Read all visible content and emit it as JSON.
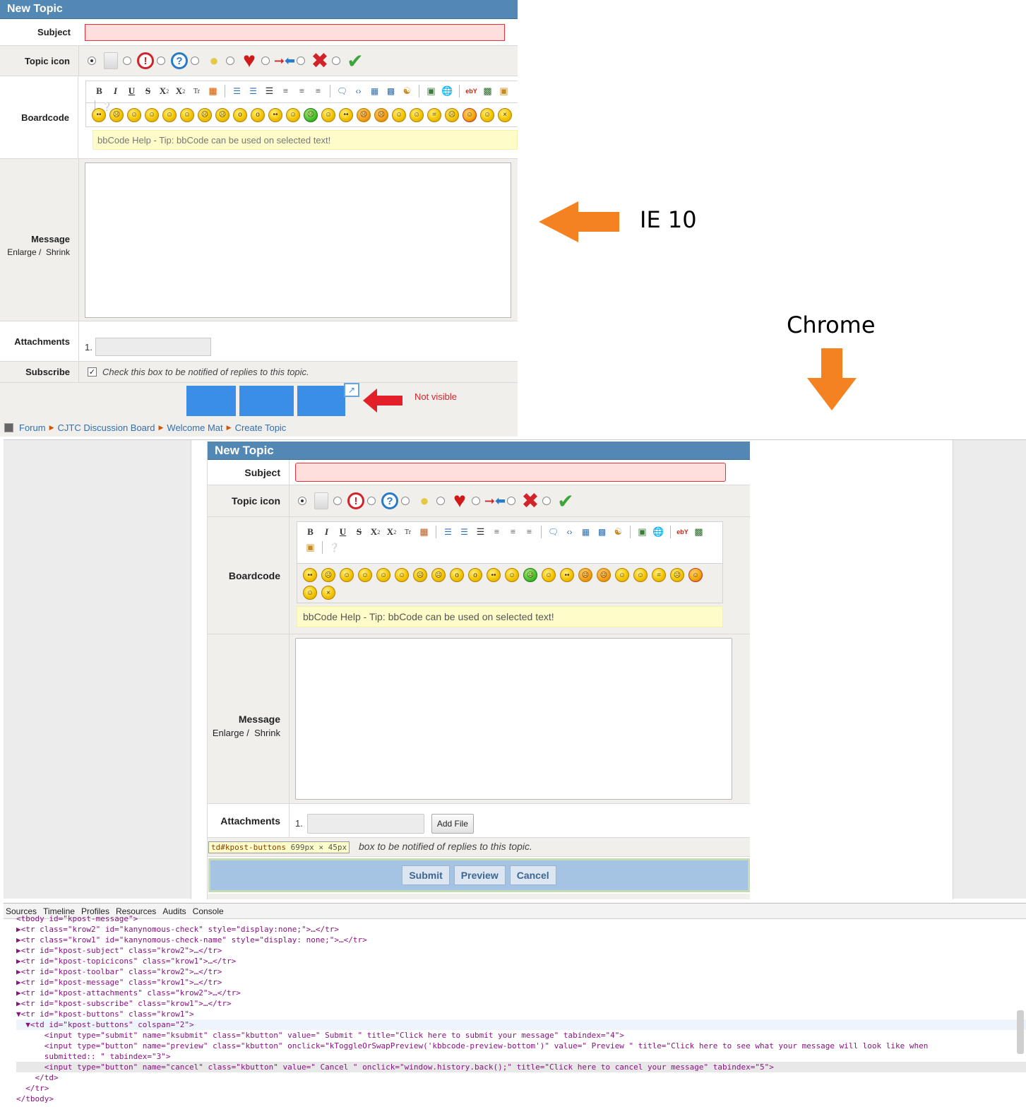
{
  "ie": {
    "title": "New Topic",
    "subject_label": "Subject",
    "topic_icon_label": "Topic icon",
    "boardcode_label": "Boardcode",
    "message_label": "Message",
    "enlarge": "Enlarge /",
    "shrink": "Shrink",
    "attachments_label": "Attachments",
    "attachment_number": "1.",
    "subscribe_label": "Subscribe",
    "subscribe_text": "Check this box to be notified of replies to this topic.",
    "bbcode_help": "bbCode Help - Tip: bbCode can be used on selected text!",
    "not_visible": "Not visible",
    "breadcrumb": [
      "Forum",
      "CJTC Discussion Board",
      "Welcome Mat",
      "Create Topic"
    ]
  },
  "annotations": {
    "ie_label": "IE 10",
    "chrome_label": "Chrome",
    "arrow_color": "#f58220",
    "red_arrow_color": "#e3202a"
  },
  "chrome": {
    "title": "New Topic",
    "subject_label": "Subject",
    "topic_icon_label": "Topic icon",
    "boardcode_label": "Boardcode",
    "message_label": "Message",
    "enlarge": "Enlarge /",
    "shrink": "Shrink",
    "attachments_label": "Attachments",
    "attachment_number": "1.",
    "add_file": "Add File",
    "subscribe_text_partial": "box to be notified of replies to this topic.",
    "bbcode_help": "bbCode Help - Tip: bbCode can be used on selected text!",
    "tooltip_selector": "td#kpost-buttons",
    "tooltip_size": "699px × 45px",
    "buttons": [
      "Submit",
      "Preview",
      "Cancel"
    ]
  },
  "devtools": {
    "tabs": [
      "Sources",
      "Timeline",
      "Profiles",
      "Resources",
      "Audits",
      "Console"
    ],
    "lines": [
      "<tbody id=\"kpost-message\">",
      "▶<tr class=\"krow2\" id=\"kanynomous-check\" style=\"display:none;\">…</tr>",
      "▶<tr class=\"krow1\" id=\"kanynomous-check-name\" style=\"display: none;\">…</tr>",
      "▶<tr id=\"kpost-subject\" class=\"krow2\">…</tr>",
      "▶<tr id=\"kpost-topicicons\" class=\"krow1\">…</tr>",
      "▶<tr id=\"kpost-toolbar\" class=\"krow2\">…</tr>",
      "▶<tr id=\"kpost-message\" class=\"krow1\">…</tr>",
      "▶<tr id=\"kpost-attachments\" class=\"krow2\">…</tr>",
      "▶<tr id=\"kpost-subscribe\" class=\"krow1\">…</tr>",
      "▼<tr id=\"kpost-buttons\" class=\"krow1\">",
      "  ▼<td id=\"kpost-buttons\" colspan=\"2\">",
      "      <input type=\"submit\" name=\"ksubmit\" class=\"kbutton\" value=\" Submit \" title=\"Click here to submit your message\" tabindex=\"4\">",
      "      <input type=\"button\" name=\"preview\" class=\"kbutton\" onclick=\"kToggleOrSwapPreview('kbbcode-preview-bottom')\" value=\" Preview \" title=\"Click here to see what your message will look like when",
      "      submitted:: \" tabindex=\"3\">",
      "      <input type=\"button\" name=\"cancel\" class=\"kbutton\" value=\" Cancel \" onclick=\"window.history.back();\" title=\"Click here to cancel your message\" tabindex=\"5\">",
      "    </td>",
      "  </tr>",
      "</tbody>"
    ]
  },
  "colors": {
    "header_blue": "#5388b4",
    "row_gray": "#f0efeb",
    "subject_bg": "#ffdede",
    "help_bg": "#fefdc9",
    "button_highlight": "#a5c3e3",
    "link_blue": "#2f6fb3"
  },
  "icons": {
    "topic": [
      "default-icon",
      "exclamation-icon",
      "question-icon",
      "lightbulb-icon",
      "heart-icon",
      "arrows-icon",
      "x-icon",
      "check-icon"
    ]
  }
}
